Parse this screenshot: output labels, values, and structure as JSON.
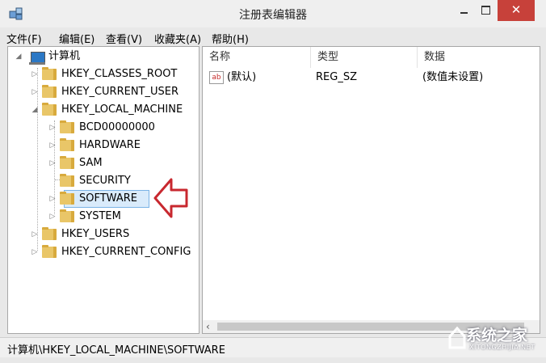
{
  "window": {
    "title": "注册表编辑器",
    "close_glyph": "✕"
  },
  "menu": [
    {
      "label": "文件(F)"
    },
    {
      "label": "编辑(E)"
    },
    {
      "label": "查看(V)"
    },
    {
      "label": "收藏夹(A)"
    },
    {
      "label": "帮助(H)"
    }
  ],
  "tree": {
    "root": "计算机",
    "hives": [
      "HKEY_CLASSES_ROOT",
      "HKEY_CURRENT_USER",
      "HKEY_LOCAL_MACHINE",
      "BCD00000000",
      "HARDWARE",
      "SAM",
      "SECURITY",
      "SOFTWARE",
      "SYSTEM",
      "HKEY_USERS",
      "HKEY_CURRENT_CONFIG"
    ],
    "selected": "SOFTWARE"
  },
  "list": {
    "columns": [
      "名称",
      "类型",
      "数据"
    ],
    "rows": [
      {
        "icon": "ab",
        "name": "(默认)",
        "type": "REG_SZ",
        "data": "(数值未设置)"
      }
    ]
  },
  "status": {
    "path": "计算机\\HKEY_LOCAL_MACHINE\\SOFTWARE"
  },
  "watermark": {
    "text": "系统之家",
    "sub": "XITONGZHIJIA.NET"
  },
  "colors": {
    "close": "#c7413a",
    "selection": "#d9ebfb",
    "arrow": "#c8282f",
    "folder": "#e9c668"
  },
  "icons": [
    "registry-app-icon",
    "computer-icon",
    "folder-icon",
    "string-value-icon",
    "red-arrow-icon"
  ]
}
